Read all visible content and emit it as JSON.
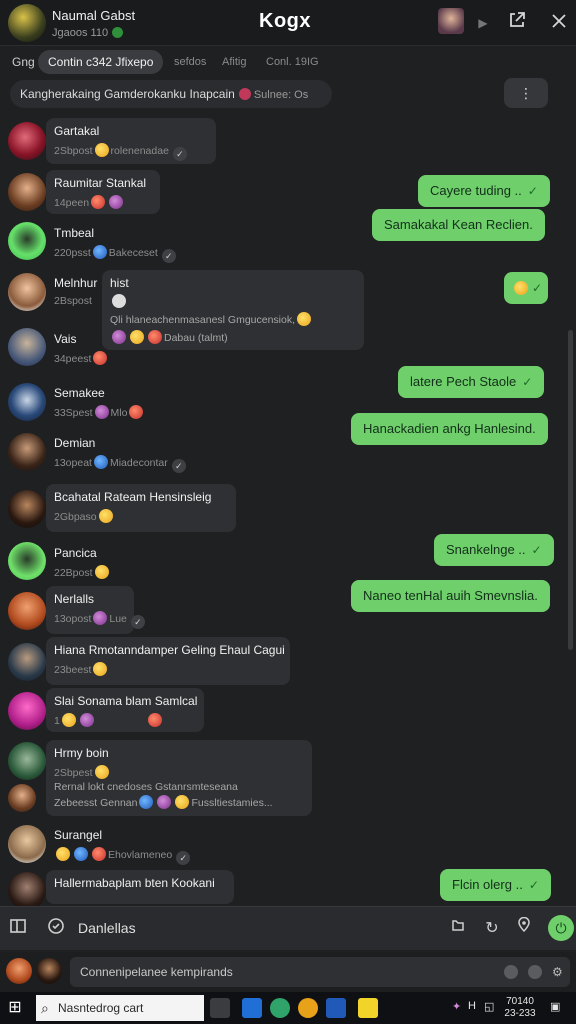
{
  "titlebar": {
    "name": "Naumal Gabst",
    "sub": "Jgaoos   110",
    "title": "Kogx"
  },
  "tabs": [
    {
      "label": "Gng",
      "active": false
    },
    {
      "label": "Contin c342 Jfixepo",
      "active": true
    },
    {
      "label": "sefdos",
      "active": false
    },
    {
      "label": "Afitig",
      "active": false
    },
    {
      "label": "Conl. 19IG",
      "active": false
    }
  ],
  "notice": {
    "text": "Kangherakaing Gamderokanku Inapcain",
    "tail": "Sulnee: Os"
  },
  "messages": [
    {
      "name": "Gartakal",
      "meta": "2Sbpost",
      "tail": "rolenenadae"
    },
    {
      "name": "Raumitar Stankal",
      "meta": "14peen",
      "tail": ""
    },
    {
      "name": "Tmbeal",
      "meta": "220psst",
      "tail": "Bakeceset"
    },
    {
      "name": "Melnhur",
      "meta": "2Bspost",
      "quote_title": "hist",
      "quote_body": "Qli hlaneachenmasanesl Gmgucensiok,",
      "quote_tail": "Dabau (talmt)"
    },
    {
      "name": "Vais",
      "meta": "34peest",
      "tail": ""
    },
    {
      "name": "Semakee",
      "meta": "33Spest",
      "tail": "Mlo"
    },
    {
      "name": "Demian",
      "meta": "13opeat",
      "tail": "Miadecontar"
    },
    {
      "name": "Bcahatal Rateam Hensinsleig",
      "meta": "2Gbpaso",
      "tail": ""
    },
    {
      "name": "Pancica",
      "meta": "22Bpost",
      "tail": ""
    },
    {
      "name": "Nerlalls",
      "meta": "13opost",
      "tail": "Lue"
    },
    {
      "name": "Hiana Rmotanndamper Geling Ehaul Cagui",
      "meta": "23beest",
      "tail": ""
    },
    {
      "name": "Slai Sonama blam Samlcal",
      "meta": "1",
      "tail": ""
    },
    {
      "name": "Hrmy boin",
      "meta": "2Sbpest",
      "line2": "Rernal lokt cnedoses Gstanrsmteseana",
      "line3": "Zebeesst Gennan",
      "line3_tail": "Fussltiestamies..."
    },
    {
      "name": "Surangel",
      "meta": "",
      "tail": "Ehovlameneo"
    },
    {
      "name": "Hallermabaplam bten Kookani",
      "meta": "",
      "tail": ""
    }
  ],
  "sent": [
    "Cayere tuding ..",
    "Samakakal Kean Reclien.",
    "",
    "latere Pech Staole",
    "Hanackadien ankg Hanlesind.",
    "Snankelnge ..",
    "Naneo tenHal auih Smevnslia.",
    "Flcin olerg .."
  ],
  "composer": {
    "text": "Danlellas",
    "input_placeholder": "Connenipelanee kempirands"
  },
  "taskbar": {
    "search": "Nasntedrog cart",
    "clock_time": "70140",
    "clock_date": "23-233"
  },
  "colors": {
    "accent_green": "#6fcf6b",
    "bubble_dark": "#2e3033",
    "background": "#1f2022"
  }
}
